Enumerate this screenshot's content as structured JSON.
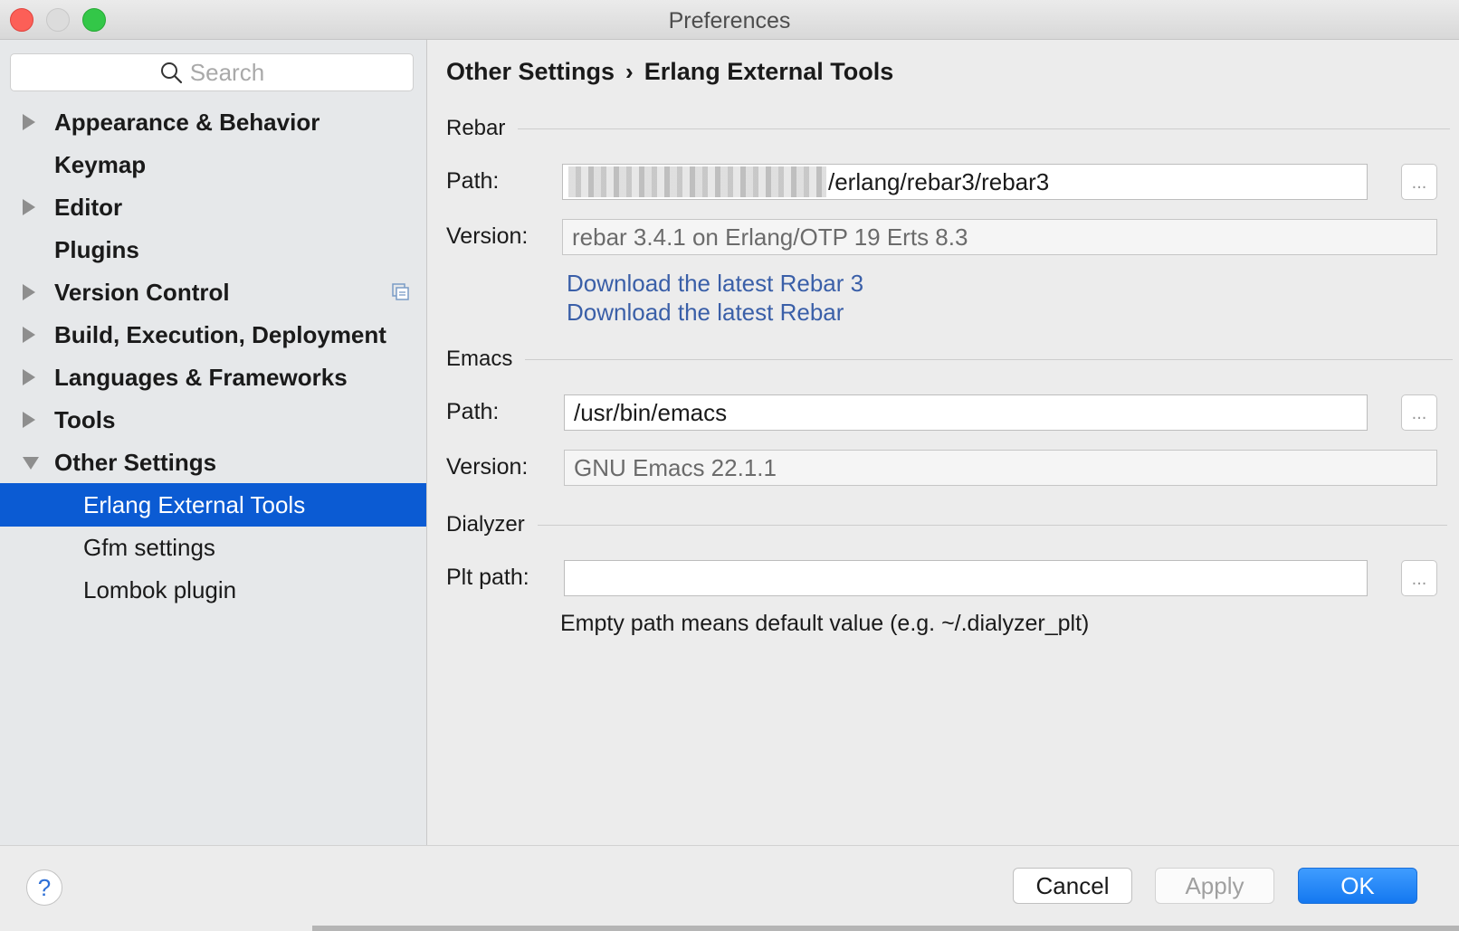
{
  "window": {
    "title": "Preferences"
  },
  "sidebar": {
    "search_placeholder": "Search",
    "items": [
      {
        "label": "Appearance & Behavior",
        "expandable": true
      },
      {
        "label": "Keymap",
        "expandable": false
      },
      {
        "label": "Editor",
        "expandable": true
      },
      {
        "label": "Plugins",
        "expandable": false
      },
      {
        "label": "Version Control",
        "expandable": true
      },
      {
        "label": "Build, Execution, Deployment",
        "expandable": true
      },
      {
        "label": "Languages & Frameworks",
        "expandable": true
      },
      {
        "label": "Tools",
        "expandable": true
      },
      {
        "label": "Other Settings",
        "expandable": true,
        "expanded": true
      }
    ],
    "children": [
      {
        "label": "Erlang External Tools",
        "selected": true
      },
      {
        "label": "Gfm settings"
      },
      {
        "label": "Lombok plugin"
      }
    ]
  },
  "content": {
    "breadcrumb": {
      "parent": "Other Settings",
      "separator": "›",
      "current": "Erlang External Tools"
    },
    "rebar": {
      "section": "Rebar",
      "path_label": "Path:",
      "path_value": "/erlang/rebar3/rebar3",
      "version_label": "Version:",
      "version_value": "rebar 3.4.1 on Erlang/OTP 19 Erts 8.3",
      "link_rebar3": "Download the latest Rebar 3",
      "link_rebar": "Download the latest Rebar"
    },
    "emacs": {
      "section": "Emacs",
      "path_label": "Path:",
      "path_value": "/usr/bin/emacs",
      "version_label": "Version:",
      "version_value": "GNU Emacs 22.1.1"
    },
    "dialyzer": {
      "section": "Dialyzer",
      "plt_label": "Plt path:",
      "plt_value": "",
      "hint": "Empty path means default value (e.g. ~/.dialyzer_plt)"
    },
    "browse_label": "..."
  },
  "footer": {
    "help": "?",
    "cancel": "Cancel",
    "apply": "Apply",
    "ok": "OK"
  },
  "colors": {
    "selection": "#0b5bd3",
    "link": "#3a5fa8",
    "ok_button": "#1478f0"
  }
}
